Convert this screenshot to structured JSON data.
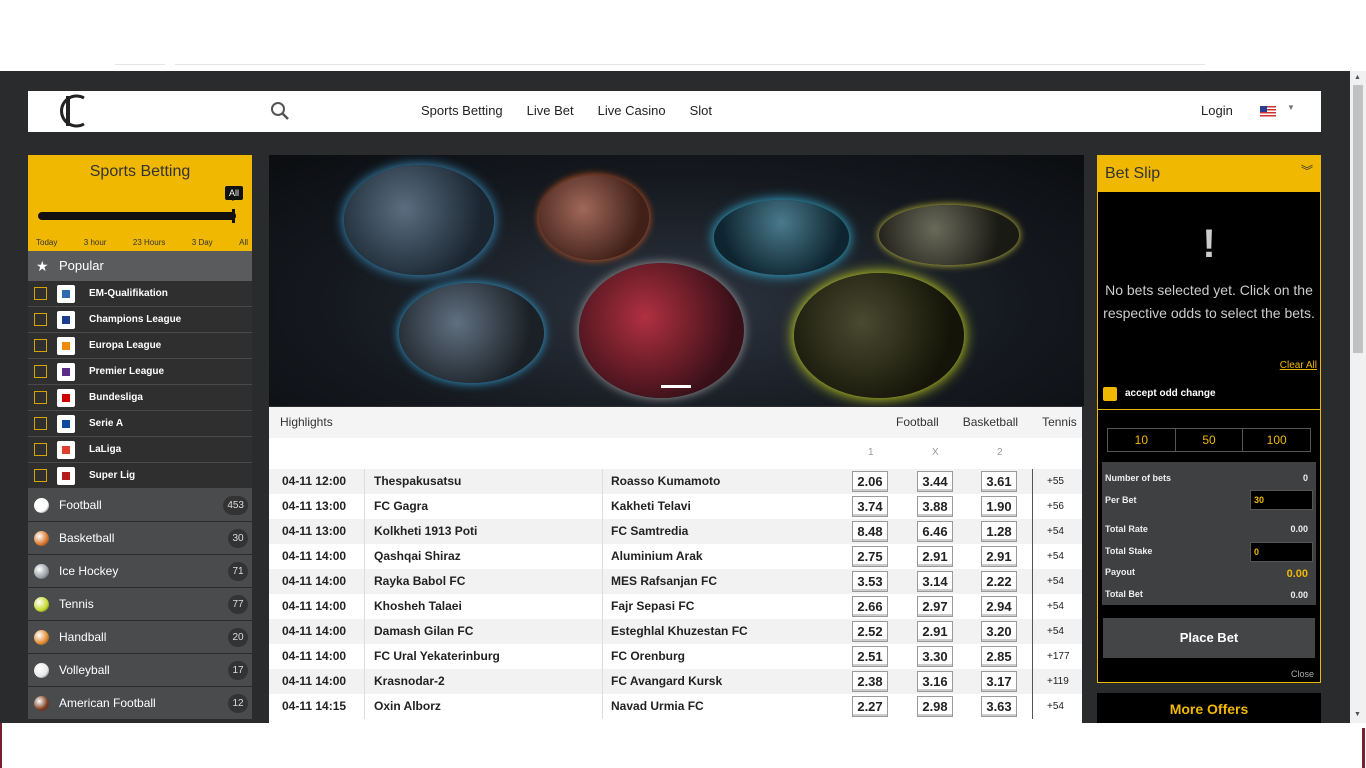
{
  "header": {
    "nav": [
      "Sports Betting",
      "Live Bet",
      "Live Casino",
      "Slot"
    ],
    "login_label": "Login"
  },
  "sidebar": {
    "title": "Sports Betting",
    "time_filter": {
      "selected": "All",
      "ticks": [
        "Today",
        "3 hour",
        "23 Hours",
        "3 Day",
        "All"
      ]
    },
    "popular_label": "Popular",
    "leagues": [
      "EM-Qualifikation",
      "Champions League",
      "Europa League",
      "Premier League",
      "Bundesliga",
      "Serie A",
      "LaLiga",
      "Super Lig"
    ],
    "sports": [
      {
        "name": "Football",
        "count": "453",
        "color": "#ffffff"
      },
      {
        "name": "Basketball",
        "count": "30",
        "color": "#d9762b"
      },
      {
        "name": "Ice Hockey",
        "count": "71",
        "color": "#9aa0a6"
      },
      {
        "name": "Tennis",
        "count": "77",
        "color": "#c8d92a"
      },
      {
        "name": "Handball",
        "count": "20",
        "color": "#e08a2e"
      },
      {
        "name": "Volleyball",
        "count": "17",
        "color": "#e8e8e8"
      },
      {
        "name": "American Football",
        "count": "12",
        "color": "#7a3b1c"
      }
    ]
  },
  "highlights": {
    "title": "Highlights",
    "tabs": [
      "Football",
      "Basketball",
      "Tennis"
    ],
    "active_tab": "Football",
    "col_labels": [
      "1",
      "X",
      "2"
    ],
    "matches": [
      {
        "date": "04-11 12:00",
        "home": "Thespakusatsu",
        "away": "Roasso Kumamoto",
        "o1": "2.06",
        "ox": "3.44",
        "o2": "3.61",
        "more": "+55"
      },
      {
        "date": "04-11 13:00",
        "home": "FC Gagra",
        "away": "Kakheti Telavi",
        "o1": "3.74",
        "ox": "3.88",
        "o2": "1.90",
        "more": "+56"
      },
      {
        "date": "04-11 13:00",
        "home": "Kolkheti 1913 Poti",
        "away": "FC Samtredia",
        "o1": "8.48",
        "ox": "6.46",
        "o2": "1.28",
        "more": "+54"
      },
      {
        "date": "04-11 14:00",
        "home": "Qashqai Shiraz",
        "away": "Aluminium Arak",
        "o1": "2.75",
        "ox": "2.91",
        "o2": "2.91",
        "more": "+54"
      },
      {
        "date": "04-11 14:00",
        "home": "Rayka Babol FC",
        "away": "MES Rafsanjan FC",
        "o1": "3.53",
        "ox": "3.14",
        "o2": "2.22",
        "more": "+54"
      },
      {
        "date": "04-11 14:00",
        "home": "Khosheh Talaei",
        "away": "Fajr Sepasi FC",
        "o1": "2.66",
        "ox": "2.97",
        "o2": "2.94",
        "more": "+54"
      },
      {
        "date": "04-11 14:00",
        "home": "Damash Gilan FC",
        "away": "Esteghlal Khuzestan FC",
        "o1": "2.52",
        "ox": "2.91",
        "o2": "3.20",
        "more": "+54"
      },
      {
        "date": "04-11 14:00",
        "home": "FC Ural Yekaterinburg",
        "away": "FC Orenburg",
        "o1": "2.51",
        "ox": "3.30",
        "o2": "2.85",
        "more": "+177"
      },
      {
        "date": "04-11 14:00",
        "home": "Krasnodar-2",
        "away": "FC Avangard Kursk",
        "o1": "2.38",
        "ox": "3.16",
        "o2": "3.17",
        "more": "+119"
      },
      {
        "date": "04-11 14:15",
        "home": "Oxin Alborz",
        "away": "Navad Urmia FC",
        "o1": "2.27",
        "ox": "2.98",
        "o2": "3.63",
        "more": "+54"
      }
    ]
  },
  "betslip": {
    "title": "Bet Slip",
    "empty_message": "No bets selected yet. Click on the respective odds to select the bets.",
    "clear_all": "Clear All",
    "accept_label": "accept odd change",
    "stakes": [
      "10",
      "50",
      "100"
    ],
    "number_of_bets_label": "Number of bets",
    "number_of_bets": "0",
    "per_bet_label": "Per Bet",
    "per_bet": "30",
    "total_rate_label": "Total Rate",
    "total_rate": "0.00",
    "total_stake_label": "Total Stake",
    "total_stake": "0",
    "payout_label": "Payout",
    "payout": "0.00",
    "total_bet_label": "Total Bet",
    "total_bet": "0.00",
    "place_bet": "Place Bet",
    "close": "Close"
  },
  "more_offers": "More Offers",
  "colors": {
    "accent": "#f0b800",
    "dark": "#2a2b2c"
  }
}
